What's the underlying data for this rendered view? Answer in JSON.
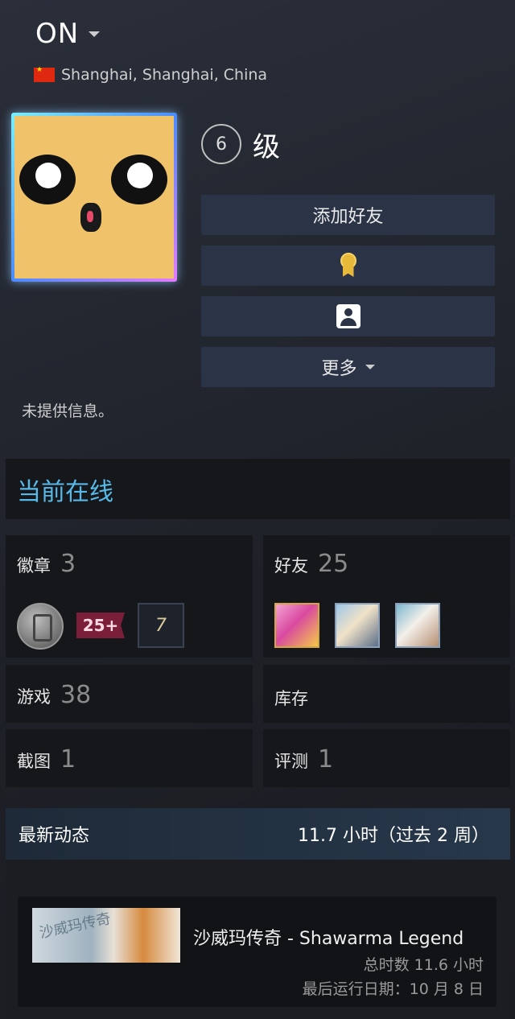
{
  "profile": {
    "username": "ON",
    "location": "Shanghai, Shanghai, China",
    "level_number": "6",
    "level_suffix": "级",
    "no_info": "未提供信息。"
  },
  "actions": {
    "add_friend": "添加好友",
    "more": "更多"
  },
  "status": {
    "online": "当前在线"
  },
  "stats": {
    "badges": {
      "label": "徽章",
      "count": "3",
      "badge2_text": "25+",
      "badge3_text": "7"
    },
    "friends": {
      "label": "好友",
      "count": "25"
    },
    "games": {
      "label": "游戏",
      "count": "38"
    },
    "inventory": {
      "label": "库存"
    },
    "screenshots": {
      "label": "截图",
      "count": "1"
    },
    "reviews": {
      "label": "评测",
      "count": "1"
    }
  },
  "recent": {
    "title": "最新动态",
    "hours": "11.7 小时（过去 2 周）",
    "game": {
      "name": "沙威玛传奇 - Shawarma Legend",
      "thumb_text": "沙威玛传奇",
      "total": "总时数 11.6 小时",
      "last_played": "最后运行日期：10 月 8 日"
    }
  },
  "colors": {
    "accent_online": "#57b9e8",
    "button_bg": "#2b3346",
    "medal": "#e7b93a"
  }
}
